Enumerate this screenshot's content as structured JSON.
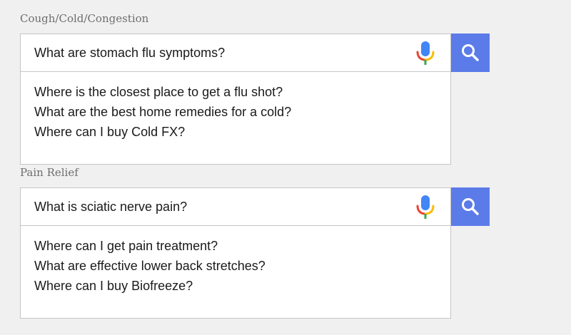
{
  "sections": [
    {
      "label": "Cough/Cold/Congestion",
      "query": "What are stomach flu symptoms?",
      "suggestions": [
        "Where is the closest place to get a flu shot?",
        "What are the best home remedies for a cold?",
        "Where can I buy Cold FX?"
      ]
    },
    {
      "label": "Pain Relief",
      "query": "What is sciatic nerve pain?",
      "suggestions": [
        "Where can I get pain treatment?",
        "What are effective lower back stretches?",
        "Where can I buy Biofreeze?"
      ]
    }
  ],
  "icons": {
    "mic": "microphone-icon",
    "search": "search-icon"
  },
  "colors": {
    "search_button": "#5b7be8",
    "mic_blue": "#4285f4",
    "mic_red": "#ea4335",
    "mic_yellow": "#fbbc05",
    "mic_green": "#34a853"
  }
}
